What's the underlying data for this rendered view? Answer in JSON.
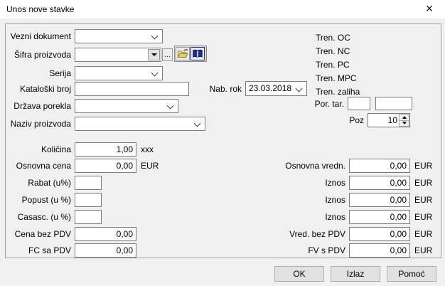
{
  "window": {
    "title": "Unos nove stavke",
    "close_glyph": "×"
  },
  "fields": {
    "vezni_dokument": {
      "label": "Vezni dokument",
      "value": ""
    },
    "sifra_proizvoda": {
      "label": "Šifra proizvoda",
      "value": "",
      "more_label": "…"
    },
    "serija": {
      "label": "Serija",
      "value": ""
    },
    "kataloski_broj": {
      "label": "Kataloški broj",
      "value": ""
    },
    "nab_rok": {
      "label": "Nab. rok",
      "value": "23.03.2018"
    },
    "drzava_porekla": {
      "label": "Država porekla",
      "value": ""
    },
    "naziv_proizvoda": {
      "label": "Naziv proizvoda",
      "value": ""
    },
    "por_tar": {
      "label": "Por. tar.",
      "value1": "",
      "value2": ""
    },
    "poz": {
      "label": "Poz",
      "value": "10"
    }
  },
  "current_info": [
    "Tren. OC",
    "Tren. NC",
    "Tren. PC",
    "Tren. MPC",
    "Tren. zaliha"
  ],
  "amounts_left": [
    {
      "label": "Količina",
      "value": "1,00",
      "suffix": "xxx"
    },
    {
      "label": "Osnovna cena",
      "value": "0,00",
      "suffix": "EUR"
    },
    {
      "label": "Rabat (u%)",
      "value": "",
      "suffix": ""
    },
    {
      "label": "Popust (u %)",
      "value": "",
      "suffix": ""
    },
    {
      "label": "Casasc. (u %)",
      "value": "",
      "suffix": ""
    },
    {
      "label": "Cena bez PDV",
      "value": "0,00",
      "suffix": ""
    },
    {
      "label": "FC sa PDV",
      "value": "0,00",
      "suffix": ""
    }
  ],
  "amounts_right": [
    {
      "label": "Osnovna vredn.",
      "value": "0,00",
      "suffix": "EUR"
    },
    {
      "label": "Iznos",
      "value": "0,00",
      "suffix": "EUR"
    },
    {
      "label": "Iznos",
      "value": "0,00",
      "suffix": "EUR"
    },
    {
      "label": "Iznos",
      "value": "0,00",
      "suffix": "EUR"
    },
    {
      "label": "Vred. bez PDV",
      "value": "0,00",
      "suffix": "EUR"
    },
    {
      "label": "FV s PDV",
      "value": "0,00",
      "suffix": "EUR"
    }
  ],
  "buttons": {
    "ok": "OK",
    "izlaz": "Izlaz",
    "pomoc": "Pomoć"
  }
}
